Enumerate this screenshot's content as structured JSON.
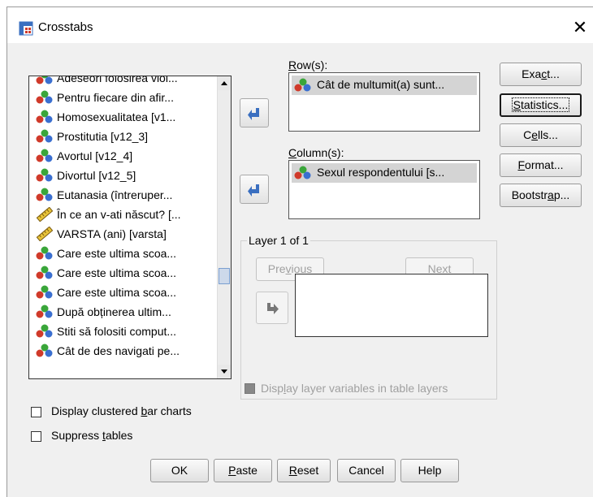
{
  "window": {
    "title": "Crosstabs",
    "close_symbol": "✕"
  },
  "variable_list": {
    "items": [
      {
        "label": "Adeseori folosirea viol...",
        "icon": "nominal-icon"
      },
      {
        "label": "Pentru fiecare din afir...",
        "icon": "nominal-icon"
      },
      {
        "label": "Homosexualitatea [v1...",
        "icon": "nominal-icon"
      },
      {
        "label": "Prostitutia [v12_3]",
        "icon": "nominal-icon"
      },
      {
        "label": "Avortul [v12_4]",
        "icon": "nominal-icon"
      },
      {
        "label": "Divortul [v12_5]",
        "icon": "nominal-icon"
      },
      {
        "label": "Eutanasia (întreruper...",
        "icon": "nominal-icon"
      },
      {
        "label": "În ce an v-ati născut? [...",
        "icon": "scale-icon"
      },
      {
        "label": "VARSTA (ani) [varsta]",
        "icon": "scale-icon"
      },
      {
        "label": "Care este ultima scoa...",
        "icon": "nominal-icon"
      },
      {
        "label": "Care este ultima scoa...",
        "icon": "nominal-icon"
      },
      {
        "label": "Care este ultima scoa...",
        "icon": "nominal-icon"
      },
      {
        "label": "După obținerea ultim...",
        "icon": "nominal-icon"
      },
      {
        "label": "Stiti să folositi comput...",
        "icon": "nominal-icon"
      },
      {
        "label": "Cât de des navigati pe...",
        "icon": "nominal-icon"
      }
    ]
  },
  "rows": {
    "label_pre": "",
    "label_u": "R",
    "label_post": "ow(s):",
    "item": "Cât de multumit(a) sunt..."
  },
  "columns": {
    "label_pre": "",
    "label_u": "C",
    "label_post": "olumn(s):",
    "item": "Sexul respondentului [s..."
  },
  "layer": {
    "title": "Layer 1 of 1",
    "previous": {
      "pre": "Pre",
      "u": "v",
      "post": "ious"
    },
    "next": {
      "pre": "",
      "u": "N",
      "post": "ext"
    }
  },
  "display_layer": {
    "pre": "Disp",
    "u": "l",
    "post": "ay layer variables in table layers"
  },
  "side_buttons": {
    "exact": {
      "pre": "Exa",
      "u": "c",
      "post": "t..."
    },
    "statistics": {
      "pre": "",
      "u": "S",
      "post": "tatistics..."
    },
    "cells": {
      "pre": "C",
      "u": "e",
      "post": "lls..."
    },
    "format": {
      "pre": "",
      "u": "F",
      "post": "ormat..."
    },
    "bootstrap": {
      "pre": "Bootstr",
      "u": "a",
      "post": "p..."
    }
  },
  "checkboxes": {
    "clustered": {
      "pre": "Display clustered ",
      "u": "b",
      "post": "ar charts",
      "checked": false
    },
    "suppress": {
      "pre": "Suppress ",
      "u": "t",
      "post": "ables",
      "checked": false
    }
  },
  "bottom_buttons": {
    "ok": {
      "pre": "OK",
      "u": "",
      "post": ""
    },
    "paste": {
      "pre": "",
      "u": "P",
      "post": "aste"
    },
    "reset": {
      "pre": "",
      "u": "R",
      "post": "eset"
    },
    "cancel": {
      "pre": "Cancel",
      "u": "",
      "post": ""
    },
    "help": {
      "pre": "Help",
      "u": "",
      "post": ""
    }
  },
  "colors": {
    "accent": "#4a7bc4",
    "arrow": "#3a6fc0",
    "nominal_red": "#d03a2a",
    "nominal_green": "#3aa63a",
    "nominal_blue": "#3a6fd0"
  }
}
